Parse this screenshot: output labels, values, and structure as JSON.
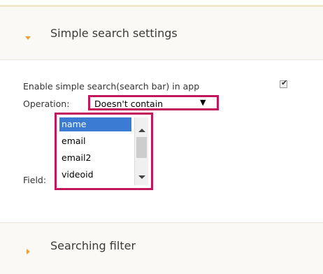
{
  "simple_search": {
    "header_title": "Simple search settings",
    "enable_label": "Enable simple search(search bar) in app",
    "enable_checked": true,
    "operation_label": "Operation:",
    "operation_value": "Doesn't contain",
    "operation_caret": "▼",
    "fields_label": "Field:",
    "fields": [
      "name",
      "email",
      "email2",
      "videoid"
    ],
    "selected_field": "name"
  },
  "filter": {
    "header_title": "Searching filter"
  },
  "colors": {
    "accent_arrow": "#e8a23a",
    "highlight_border": "#c2185b",
    "selection": "#3b7bd4"
  }
}
